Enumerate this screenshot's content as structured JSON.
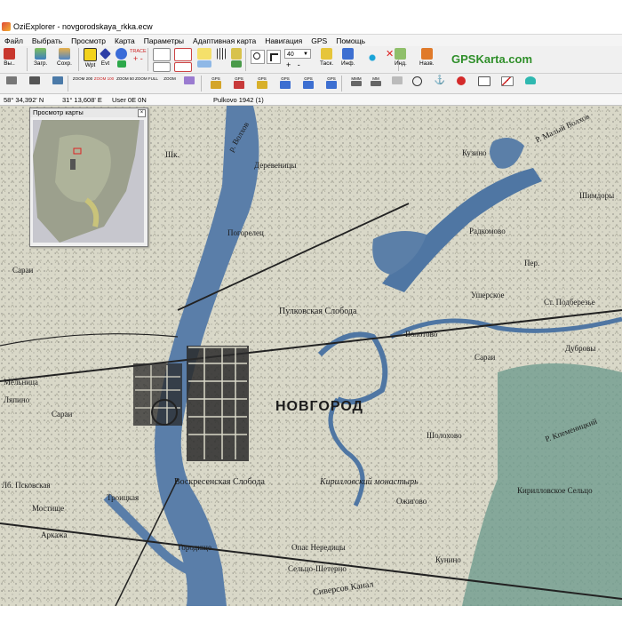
{
  "window": {
    "title": "OziExplorer - novgorodskaya_rkka.ecw"
  },
  "menu": [
    "Файл",
    "Выбрать",
    "Просмотр",
    "Карта",
    "Параметры",
    "Адаптивная карта",
    "Навигация",
    "GPS",
    "Помощь"
  ],
  "toolbar": {
    "exit_label": "Вы..",
    "load_label": "Загр.",
    "save_label": "Сохр.",
    "wpt_label": "Wpt",
    "evt_label": "Evt",
    "trace_label": "TRACE",
    "zoom_value": "40",
    "task_label": "Таск.",
    "info_label": "Инф.",
    "ind_label": "Инд.",
    "nav_label": "Назв."
  },
  "toolbar2": {
    "zoom_200": "ZOOM 200",
    "zoom_100": "ZOOM 100",
    "zoom_50": "ZOOM 50",
    "zoom_full": "ZOOM FULL",
    "zoom_plain": "ZOOM",
    "gps_labels": [
      "GPS",
      "GPS",
      "GPS",
      "GPS",
      "GPS",
      "GPS"
    ],
    "mmm_labels": [
      "MMM",
      "MM"
    ]
  },
  "brand": {
    "text": "GPSKarta.com",
    "color": "#2f8f2a"
  },
  "status": {
    "lat": "58° 34,392' N",
    "lon": "31° 13,608' E",
    "user": "User  0E   0N",
    "datum": "Pulkovo 1942 (1)"
  },
  "overview": {
    "title": "Просмотр карты"
  },
  "map_labels": [
    "НОВГОРОД",
    "Пулковская Слобода",
    "Воскресенская Слобода",
    "Кирилловский монастырь",
    "Деревеницы",
    "Погорелец",
    "Радкомово",
    "Волотово",
    "Сараи",
    "Сараи",
    "Мельница",
    "Ляпино",
    "Сараи",
    "Лб. Псковская",
    "Мостище",
    "Троицкая",
    "Аркажа",
    "Городище",
    "Опас Нередицы",
    "Сельцо-Шетерно",
    "Сиверсов Канал",
    "Кунино",
    "Ожигово",
    "Шолохово",
    "Кирилловское Сельцо",
    "Дубровы",
    "Ушерское",
    "Шимдоры",
    "Р. Малый Волхов",
    "Ст. Подберезье",
    "Р. Кпеменицкий",
    "р. Волхов",
    "Шк.",
    "Кузино",
    "Пер."
  ],
  "colors": {
    "water": "#5b7fa8",
    "map_base": "#d7d6c6",
    "river": "#4f76a3"
  }
}
